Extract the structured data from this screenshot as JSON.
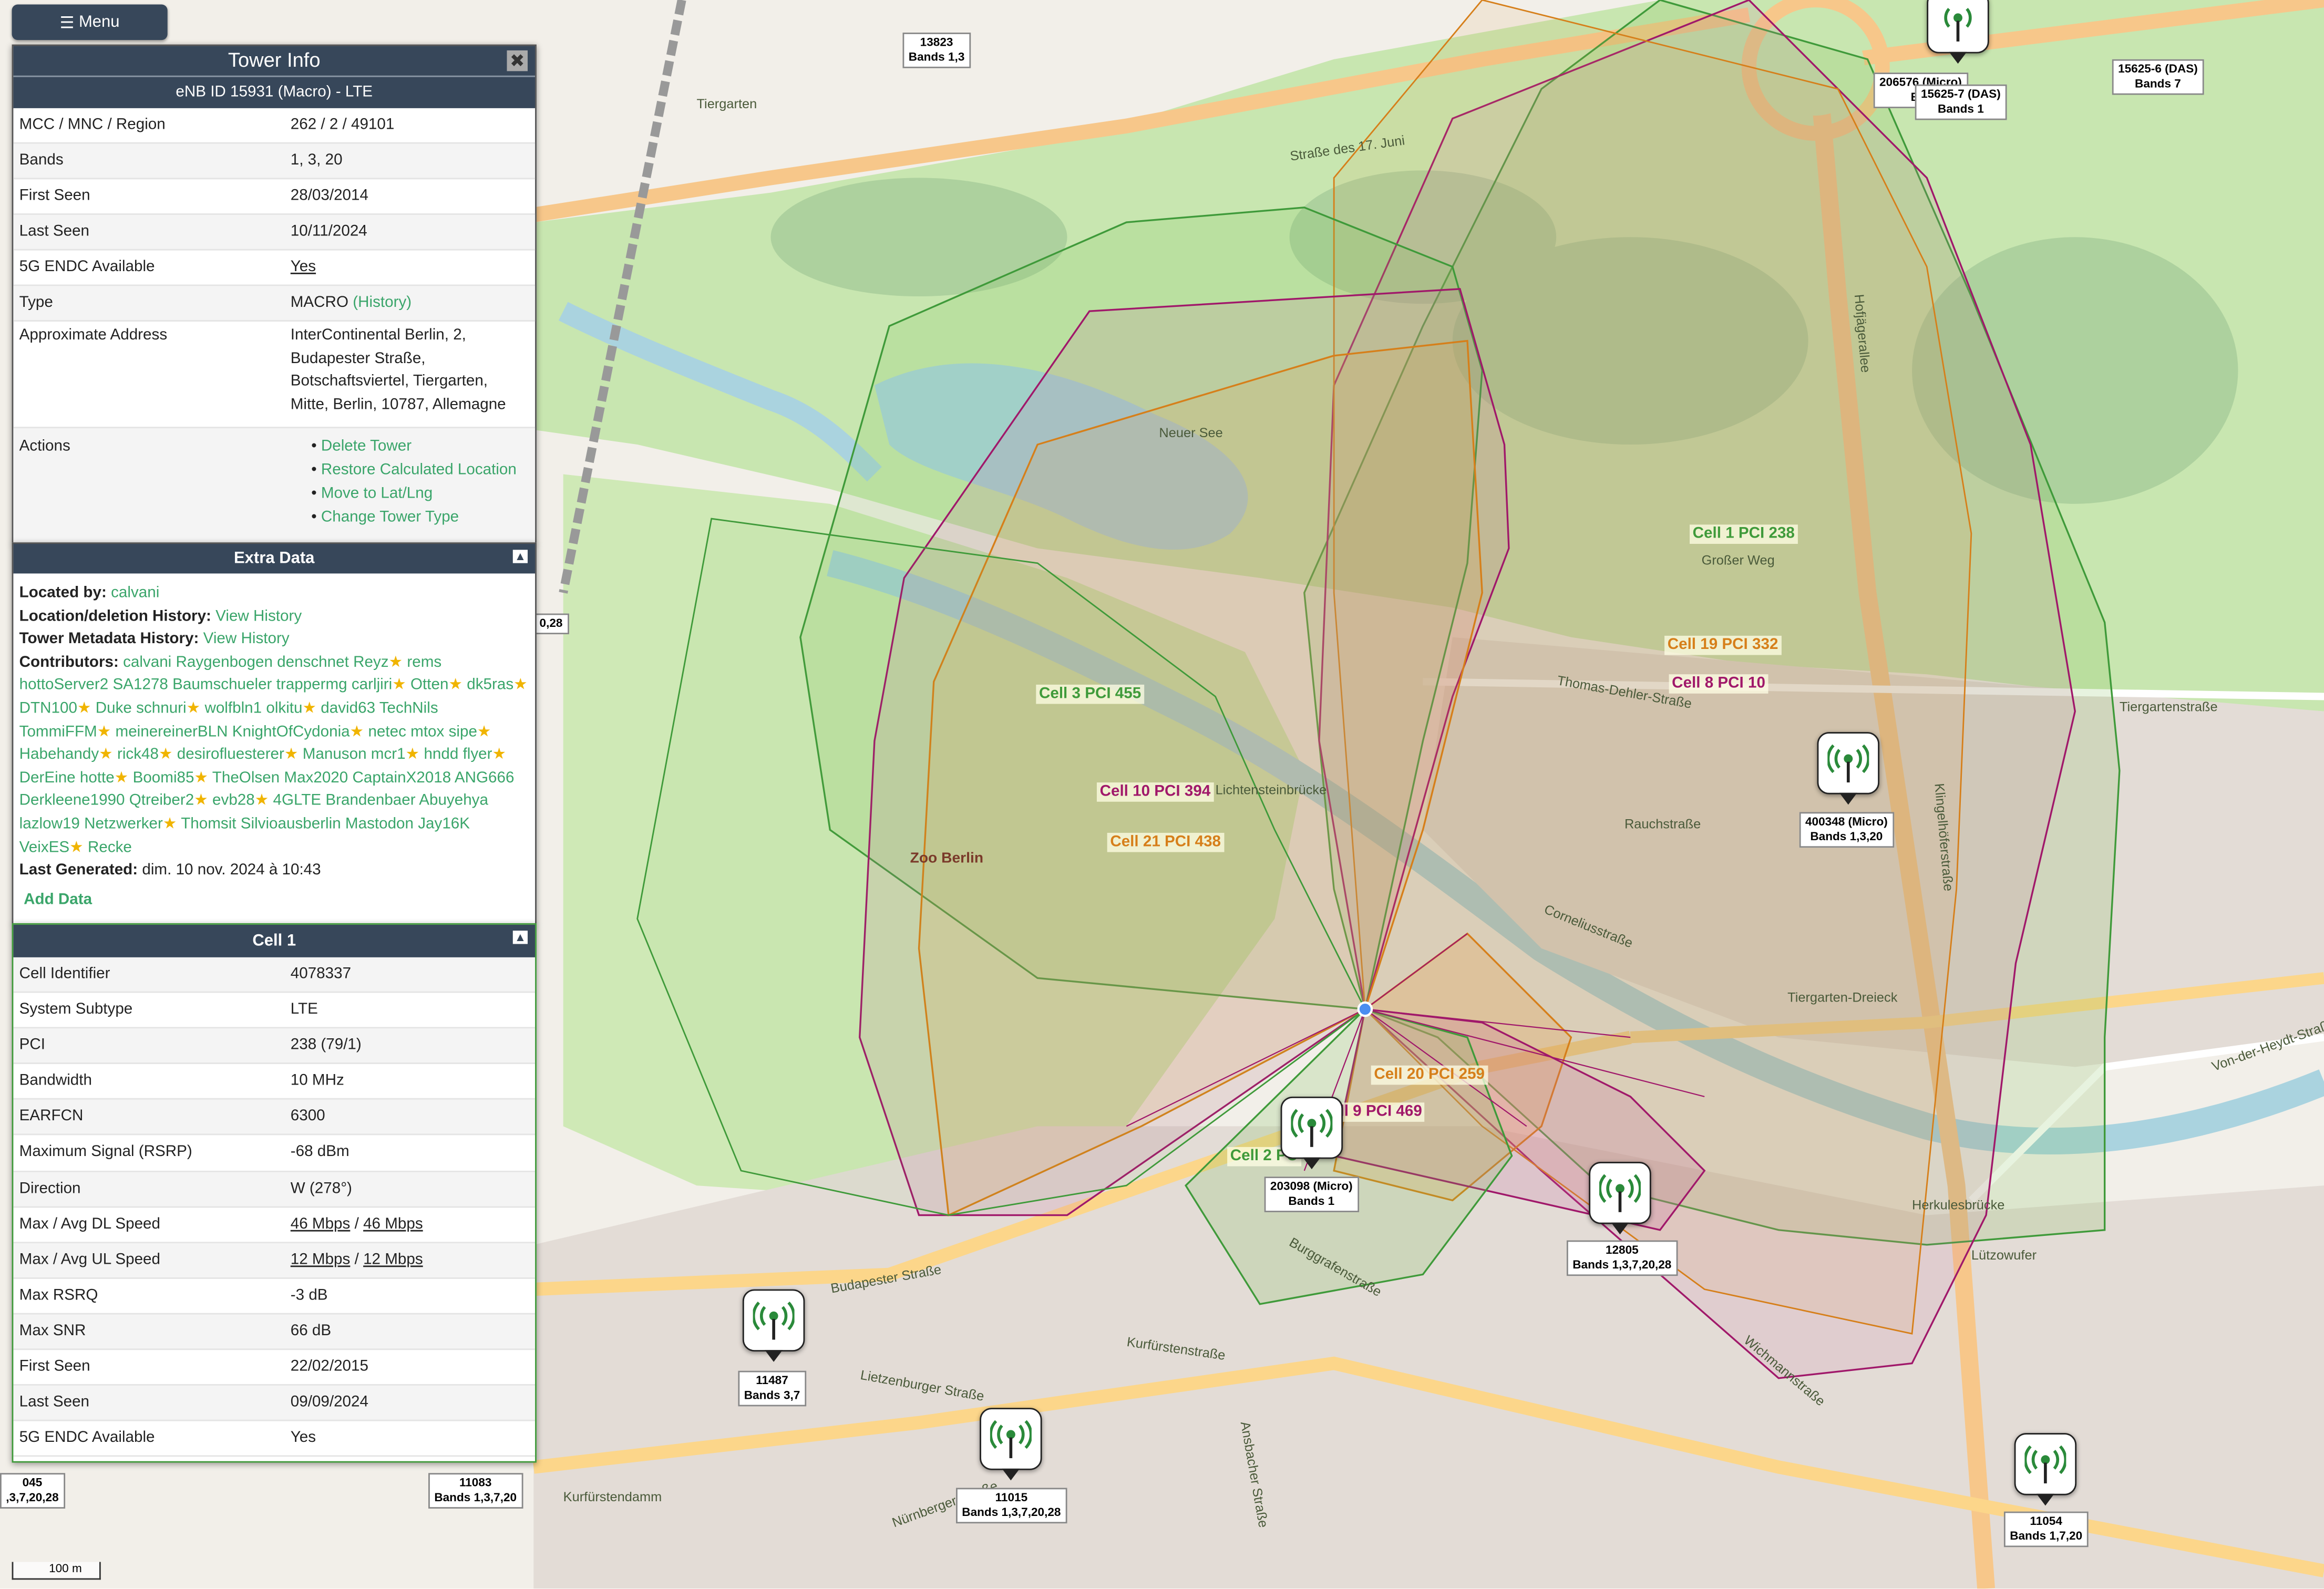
{
  "menu": {
    "label": "Menu"
  },
  "tower_info": {
    "title": "Tower Info",
    "subtitle": "eNB ID 15931 (Macro) - LTE",
    "rows": [
      {
        "key": "MCC / MNC / Region",
        "value": "262 / 2 / 49101"
      },
      {
        "key": "Bands",
        "value": "1, 3, 20"
      },
      {
        "key": "First Seen",
        "value": "28/03/2014"
      },
      {
        "key": "Last Seen",
        "value": "10/11/2024"
      },
      {
        "key": "5G ENDC Available",
        "value": "Yes"
      },
      {
        "key": "Type",
        "value": "MACRO",
        "link": "(History)"
      },
      {
        "key": "Approximate Address",
        "value": "InterContinental Berlin, 2, Budapester Straße, Botschaftsviertel, Tiergarten, Mitte, Berlin, 10787, Allemagne"
      }
    ],
    "actions_label": "Actions",
    "actions": [
      "Delete Tower",
      "Restore Calculated Location",
      "Move to Lat/Lng",
      "Change Tower Type"
    ]
  },
  "extra_data": {
    "title": "Extra Data",
    "located_by_label": "Located by:",
    "located_by": "calvani",
    "location_history_label": "Location/deletion History:",
    "location_history_link": "View History",
    "metadata_history_label": "Tower Metadata History:",
    "metadata_history_link": "View History",
    "contributors_label": "Contributors:",
    "contributors": [
      {
        "name": "calvani",
        "star": false
      },
      {
        "name": "Raygenbogen",
        "star": false
      },
      {
        "name": "denschnet",
        "star": false
      },
      {
        "name": "Reyz",
        "star": true
      },
      {
        "name": "rems",
        "star": false
      },
      {
        "name": "hottoServer2",
        "star": false
      },
      {
        "name": "SA1278",
        "star": false
      },
      {
        "name": "Baumschueler",
        "star": false
      },
      {
        "name": "trappermg",
        "star": false
      },
      {
        "name": "carljiri",
        "star": true
      },
      {
        "name": "Otten",
        "star": true
      },
      {
        "name": "dk5ras",
        "star": true
      },
      {
        "name": "DTN100",
        "star": true
      },
      {
        "name": "Duke",
        "star": false
      },
      {
        "name": "schnuri",
        "star": true
      },
      {
        "name": "wolfbln1",
        "star": false
      },
      {
        "name": "olkitu",
        "star": true
      },
      {
        "name": "david63",
        "star": false
      },
      {
        "name": "TechNils",
        "star": false
      },
      {
        "name": "TommiFFM",
        "star": true
      },
      {
        "name": "meinereinerBLN",
        "star": false
      },
      {
        "name": "KnightOfCydonia",
        "star": true
      },
      {
        "name": "netec",
        "star": false
      },
      {
        "name": "mtox",
        "star": false
      },
      {
        "name": "sipe",
        "star": true
      },
      {
        "name": "Habehandy",
        "star": true
      },
      {
        "name": "rick48",
        "star": true
      },
      {
        "name": "desirofluesterer",
        "star": true
      },
      {
        "name": "Manuson",
        "star": false
      },
      {
        "name": "mcr1",
        "star": true
      },
      {
        "name": "hndd",
        "star": false
      },
      {
        "name": "flyer",
        "star": true
      },
      {
        "name": "DerEine",
        "star": false
      },
      {
        "name": "hotte",
        "star": true
      },
      {
        "name": "Boomi85",
        "star": true
      },
      {
        "name": "TheOlsen",
        "star": false
      },
      {
        "name": "Max2020",
        "star": false
      },
      {
        "name": "CaptainX2018",
        "star": false
      },
      {
        "name": "ANG666",
        "star": false
      },
      {
        "name": "Derkleene1990",
        "star": false
      },
      {
        "name": "Qtreiber2",
        "star": true
      },
      {
        "name": "evb28",
        "star": true
      },
      {
        "name": "4GLTE",
        "star": false
      },
      {
        "name": "Brandenbaer",
        "star": false
      },
      {
        "name": "Abuyehya",
        "star": false
      },
      {
        "name": "lazlow19",
        "star": false
      },
      {
        "name": "Netzwerker",
        "star": true
      },
      {
        "name": "Thomsit",
        "star": false
      },
      {
        "name": "Silvioausberlin",
        "star": false
      },
      {
        "name": "Mastodon",
        "star": false
      },
      {
        "name": "Jay16K",
        "star": false
      },
      {
        "name": "VeixES",
        "star": true
      },
      {
        "name": "Recke",
        "star": false
      }
    ],
    "last_generated_label": "Last Generated:",
    "last_generated": "dim. 10 nov. 2024 à 10:43",
    "add_data": "Add Data"
  },
  "cell": {
    "title": "Cell 1",
    "rows": [
      {
        "key": "Cell Identifier",
        "value": "4078337"
      },
      {
        "key": "System Subtype",
        "value": "LTE"
      },
      {
        "key": "PCI",
        "value": "238 (79/1)"
      },
      {
        "key": "Bandwidth",
        "value": "10 MHz"
      },
      {
        "key": "EARFCN",
        "value": "6300"
      },
      {
        "key": "Maximum Signal (RSRP)",
        "value": "-68 dBm"
      },
      {
        "key": "Direction",
        "value": "W (278°)"
      },
      {
        "key": "Max / Avg DL Speed",
        "value": "46 Mbps / 46 Mbps"
      },
      {
        "key": "Max / Avg UL Speed",
        "value": "12 Mbps / 12 Mbps"
      },
      {
        "key": "Max RSRQ",
        "value": "-3 dB"
      },
      {
        "key": "Max SNR",
        "value": "66 dB"
      },
      {
        "key": "First Seen",
        "value": "22/02/2015"
      },
      {
        "key": "Last Seen",
        "value": "09/09/2024"
      },
      {
        "key": "5G ENDC Available",
        "value": "Yes"
      }
    ]
  },
  "cell_labels": [
    {
      "text": "Cell 1 PCI 238",
      "color": "#3f9a3a"
    },
    {
      "text": "Cell 3 PCI 455",
      "color": "#3f9a3a"
    },
    {
      "text": "Cell 10 PCI 394",
      "color": "#a0186a"
    },
    {
      "text": "Cell 21 PCI 438",
      "color": "#d67f1a"
    },
    {
      "text": "Cell 19 PCI 332",
      "color": "#d67f1a"
    },
    {
      "text": "Cell 8 PCI 10",
      "color": "#a0186a"
    },
    {
      "text": "Cell 20 PCI 259",
      "color": "#d67f1a"
    },
    {
      "text": "ll 9 PCI 469",
      "color": "#a0186a"
    },
    {
      "text": "Cell 2 PC",
      "color": "#3f9a3a"
    }
  ],
  "towers": [
    {
      "id": "13823",
      "bands": "Bands 1,3"
    },
    {
      "id": "206576 (Micro)",
      "bands": "Bar"
    },
    {
      "id": "15625-7 (DAS)",
      "bands": "Bands 1"
    },
    {
      "id": "15625-6 (DAS)",
      "bands": "Bands 7"
    },
    {
      "id": "400348 (Micro)",
      "bands": "Bands 1,3,20"
    },
    {
      "id": "203098 (Micro)",
      "bands": "Bands 1"
    },
    {
      "id": "12805",
      "bands": "Bands 1,3,7,20,28"
    },
    {
      "id": "11487",
      "bands": "Bands 3,7"
    },
    {
      "id": "11015",
      "bands": "Bands 1,3,7,20,28"
    },
    {
      "id": "11054",
      "bands": "Bands 1,7,20"
    },
    {
      "id": "11083",
      "bands": "Bands 1,3,7,20"
    },
    {
      "id": "045",
      "bands": ",3,7,20,28"
    }
  ],
  "partial_marker_label": "0,28",
  "map_labels": [
    "Zoo Berlin",
    "Neuer See",
    "Großer Weg",
    "Straße des 17. Juni",
    "Tiergarten",
    "Budapester Straße",
    "Kurfürstendamm",
    "Lichtensteinbrücke",
    "Tiergarten-Dreieck",
    "Herkulesbrücke",
    "Lützowufer",
    "Corneliusstraße",
    "Rauchstraße",
    "Thomas-Dehler-Straße",
    "Hofjägerallee",
    "Klingelhöferstraße",
    "Kurfürstenstraße",
    "Tiergartenstraße",
    "Von-der-Heydt-Straße",
    "Burggrafenstraße",
    "Nürnberger Straße",
    "Lietzenburger Straße",
    "Ansbacher Straße",
    "Wichmannstraße"
  ],
  "scale": {
    "label": "100 m"
  },
  "colors": {
    "header": "#37475a",
    "link": "#3aa56a",
    "cell_green": "#3f9a3a",
    "cell_purple": "#a0186a",
    "cell_orange": "#d67f1a"
  }
}
